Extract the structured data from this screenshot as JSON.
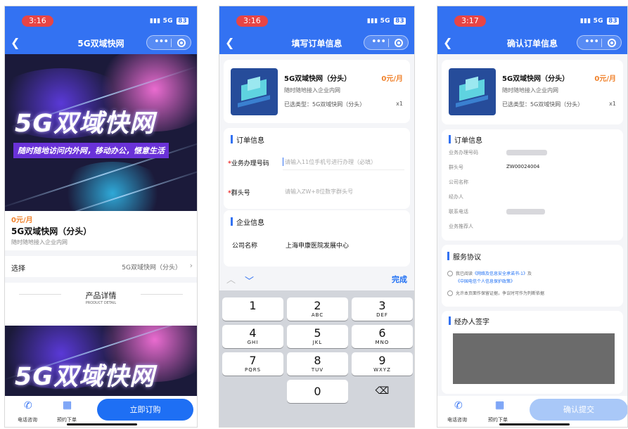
{
  "screen1": {
    "time": "3:16",
    "network": "5G",
    "battery": "83",
    "title": "5G双域快网",
    "banner_title": "5G双域快网",
    "banner_sub": "随时随地访问内外网，移动办公，惬意生活",
    "price": "0元/月",
    "product_name": "5G双域快网（分头）",
    "product_desc": "随时随地接入企业内网",
    "select_label": "选择",
    "select_value": "5G双域快网（分头）",
    "detail_title": "产品详情",
    "detail_sub": "PRODUCT DETAIL",
    "banner2_title": "5G双域快网",
    "bottom": {
      "consult": "电话咨询",
      "book": "预约下单",
      "order": "立即订购"
    }
  },
  "screen2": {
    "time": "3:16",
    "network": "5G",
    "battery": "83",
    "title": "填写订单信息",
    "product_name": "5G双域快网（分头）",
    "product_price": "0元/月",
    "product_desc": "随时随地接入企业内网",
    "selected_type": "已选类型：5G双域快网（分头）",
    "qty": "x1",
    "order_section": "订单信息",
    "business_label": "业务办理号码",
    "business_placeholder": "请输入11位手机号进行办理（必填）",
    "group_label": "群头号",
    "group_placeholder": "请输入ZW+8位数字群头号",
    "company_section": "企业信息",
    "company_label": "公司名称",
    "company_value": "上海申康医院发展中心",
    "done": "完成",
    "keys": [
      {
        "n": "1",
        "l": ""
      },
      {
        "n": "2",
        "l": "ABC"
      },
      {
        "n": "3",
        "l": "DEF"
      },
      {
        "n": "4",
        "l": "GHI"
      },
      {
        "n": "5",
        "l": "JKL"
      },
      {
        "n": "6",
        "l": "MNO"
      },
      {
        "n": "7",
        "l": "PQRS"
      },
      {
        "n": "8",
        "l": "TUV"
      },
      {
        "n": "9",
        "l": "WXYZ"
      },
      {
        "n": "0",
        "l": ""
      }
    ]
  },
  "screen3": {
    "time": "3:17",
    "network": "5G",
    "battery": "83",
    "title": "确认订单信息",
    "product_name": "5G双域快网（分头）",
    "product_price": "0元/月",
    "product_desc": "随时随地接入企业内网",
    "selected_type": "已选类型：5G双域快网（分头）",
    "qty": "x1",
    "order_section": "订单信息",
    "rows": [
      {
        "label": "业务办理号码",
        "value": ""
      },
      {
        "label": "群头号",
        "value": "ZW00024004"
      },
      {
        "label": "公司名称",
        "value": ""
      },
      {
        "label": "经办人",
        "value": ""
      },
      {
        "label": "联系电话",
        "value": ""
      },
      {
        "label": "业务推荐人",
        "value": ""
      }
    ],
    "service_section": "服务协议",
    "agree1_prefix": "我已阅读",
    "agree1_link": "《网络及信息安全承诺书-1》",
    "agree1_and": "及",
    "agree1_link2": "《中国电信个人信息保护政策》",
    "agree2": "允许本页面作保留证据，争议时可作为判断依据",
    "sign_section": "经办人签字",
    "bottom": {
      "consult": "电话咨询",
      "book": "预约下单",
      "submit": "确认提交"
    }
  }
}
